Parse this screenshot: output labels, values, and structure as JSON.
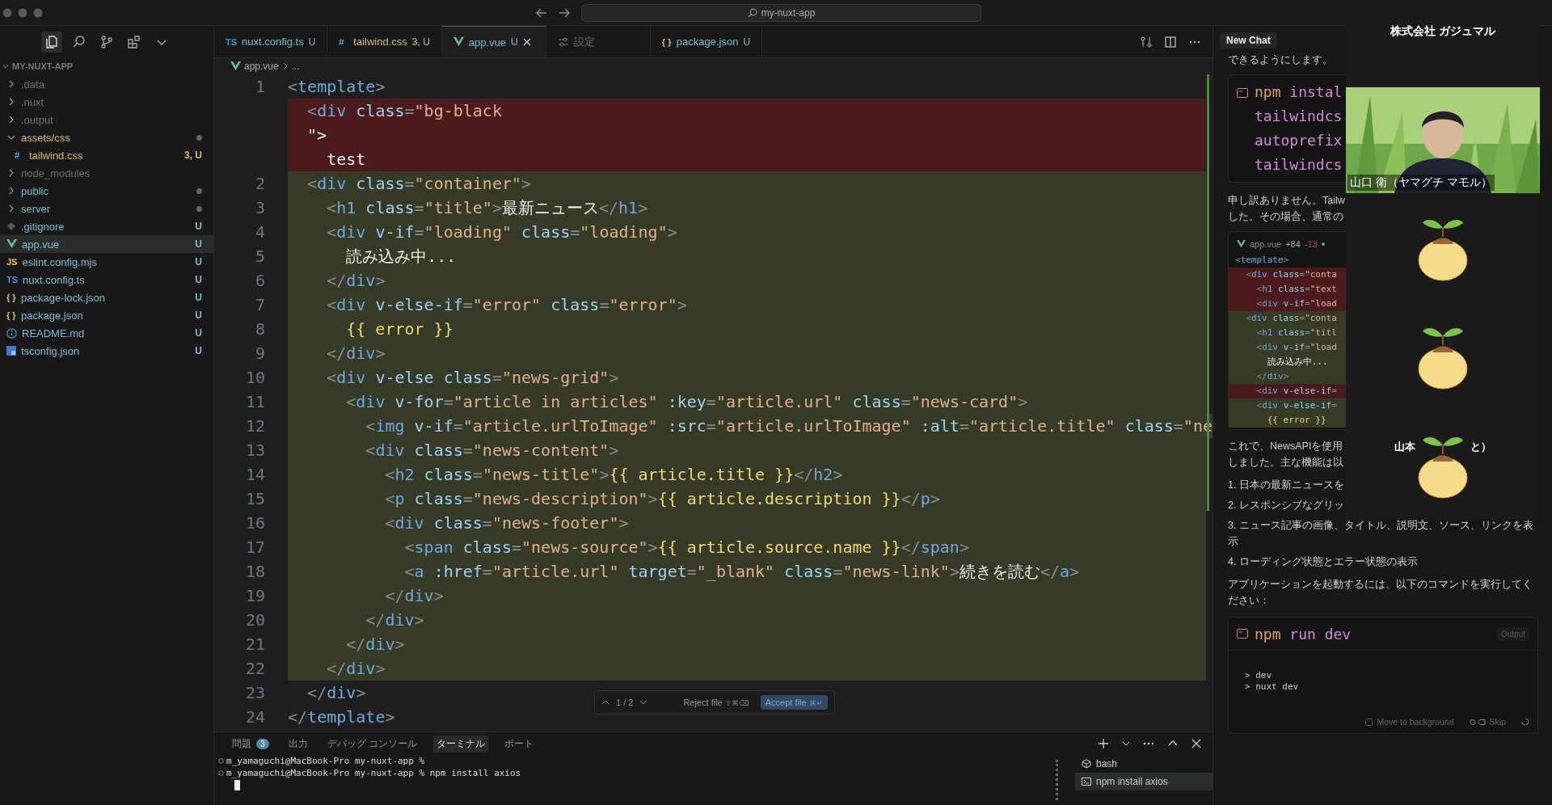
{
  "window": {
    "search": "my-nuxt-app"
  },
  "activity": [
    {
      "kind": "files",
      "selected": true
    },
    {
      "kind": "search",
      "selected": false
    },
    {
      "kind": "git",
      "selected": false
    },
    {
      "kind": "extensions",
      "selected": false
    },
    {
      "kind": "more",
      "selected": false
    }
  ],
  "explorer": {
    "title": "MY-NUXT-APP",
    "items": [
      {
        "name": ".data",
        "kind": "folder",
        "expanded": false,
        "color": "#6f6f6f",
        "selected": false
      },
      {
        "name": ".nuxt",
        "kind": "folder",
        "expanded": false,
        "color": "#6f6f6f",
        "selected": false
      },
      {
        "name": ".output",
        "kind": "folder",
        "expanded": false,
        "color": "#6f6f6f",
        "selected": false
      },
      {
        "name": "assets/css",
        "kind": "folder",
        "expanded": true,
        "color": "#d7ba7d",
        "dot": true,
        "selected": false,
        "children": [
          {
            "name": "tailwind.css",
            "kind": "css",
            "glyph": "#",
            "color": "#d7ba7d",
            "status": "3, U",
            "selected": false
          }
        ]
      },
      {
        "name": "node_modules",
        "kind": "folder",
        "expanded": false,
        "color": "#6f6f6f",
        "selected": false
      },
      {
        "name": "public",
        "kind": "folder",
        "expanded": false,
        "color": "#7fbdd0",
        "dot": true,
        "selected": false
      },
      {
        "name": "server",
        "kind": "folder",
        "expanded": false,
        "color": "#7fbdd0",
        "dot": true,
        "selected": false
      },
      {
        "name": ".gitignore",
        "kind": "gitignore",
        "color": "#7fbdd0",
        "status": "U",
        "selected": false
      },
      {
        "name": "app.vue",
        "kind": "vue",
        "color": "#7fbdd0",
        "status": "U",
        "selected": true
      },
      {
        "name": "eslint.config.mjs",
        "kind": "js",
        "glyph": "JS",
        "color": "#7fbdd0",
        "status": "U",
        "selected": false
      },
      {
        "name": "nuxt.config.ts",
        "kind": "ts",
        "glyph": "TS",
        "color": "#7fbdd0",
        "status": "U",
        "selected": false
      },
      {
        "name": "package-lock.json",
        "kind": "json",
        "glyph": "{ }",
        "color": "#7fbdd0",
        "status": "U",
        "selected": false
      },
      {
        "name": "package.json",
        "kind": "json",
        "glyph": "{ }",
        "color": "#7fbdd0",
        "status": "U",
        "selected": false
      },
      {
        "name": "README.md",
        "kind": "info",
        "color": "#7fbdd0",
        "status": "U",
        "selected": false
      },
      {
        "name": "tsconfig.json",
        "kind": "tsconfig",
        "color": "#7fbdd0",
        "status": "U",
        "selected": false
      }
    ]
  },
  "tabs": [
    {
      "label": "nuxt.config.ts",
      "kind": "ts",
      "glyph": "TS",
      "color": "#7fbdd0",
      "status": "U",
      "selected": false
    },
    {
      "label": "tailwind.css",
      "kind": "css",
      "glyph": "#",
      "color": "#d7ba7d",
      "status": "3, U",
      "selected": false
    },
    {
      "label": "app.vue",
      "kind": "vue",
      "color": "#7fbdd0",
      "status": "U",
      "selected": true
    },
    {
      "label": "設定",
      "kind": "settings",
      "color": "#6f6f6f",
      "selected": false
    },
    {
      "label": "package.json",
      "kind": "json",
      "glyph": "{ }",
      "color": "#7fbdd0",
      "status": "U",
      "selected": false
    }
  ],
  "breadcrumb": [
    "app.vue",
    "..."
  ],
  "code_lines": [
    {
      "number": "1",
      "text": "<template>",
      "deleted": false,
      "added": false
    },
    {
      "text": "  <div class=\"bg-black",
      "deleted": true,
      "added": false
    },
    {
      "text": "  \">",
      "deleted": true,
      "added": false
    },
    {
      "text": "    test",
      "deleted": true,
      "added": false
    },
    {
      "number": "2",
      "text": "  <div class=\"container\">",
      "deleted": false,
      "added": true
    },
    {
      "number": "3",
      "text": "    <h1 class=\"title\">最新ニュース</h1>",
      "deleted": false,
      "added": true
    },
    {
      "number": "4",
      "text": "    <div v-if=\"loading\" class=\"loading\">",
      "deleted": false,
      "added": true
    },
    {
      "number": "5",
      "text": "      読み込み中...",
      "deleted": false,
      "added": true
    },
    {
      "number": "6",
      "text": "    </div>",
      "deleted": false,
      "added": true
    },
    {
      "number": "7",
      "text": "    <div v-else-if=\"error\" class=\"error\">",
      "deleted": false,
      "added": true
    },
    {
      "number": "8",
      "text": "      {{ error }}",
      "deleted": false,
      "added": true
    },
    {
      "number": "9",
      "text": "    </div>",
      "deleted": false,
      "added": true
    },
    {
      "number": "10",
      "text": "    <div v-else class=\"news-grid\">",
      "deleted": false,
      "added": true
    },
    {
      "number": "11",
      "text": "      <div v-for=\"article in articles\" :key=\"article.url\" class=\"news-card\">",
      "deleted": false,
      "added": true
    },
    {
      "number": "12",
      "text": "        <img v-if=\"article.urlToImage\" :src=\"article.urlToImage\" :alt=\"article.title\" class=\"ne",
      "deleted": false,
      "added": true
    },
    {
      "number": "13",
      "text": "        <div class=\"news-content\">",
      "deleted": false,
      "added": true
    },
    {
      "number": "14",
      "text": "          <h2 class=\"news-title\">{{ article.title }}</h2>",
      "deleted": false,
      "added": true
    },
    {
      "number": "15",
      "text": "          <p class=\"news-description\">{{ article.description }}</p>",
      "deleted": false,
      "added": true
    },
    {
      "number": "16",
      "text": "          <div class=\"news-footer\">",
      "deleted": false,
      "added": true
    },
    {
      "number": "17",
      "text": "            <span class=\"news-source\">{{ article.source.name }}</span>",
      "deleted": false,
      "added": true
    },
    {
      "number": "18",
      "text": "            <a :href=\"article.url\" target=\"_blank\" class=\"news-link\">続きを読む</a>",
      "deleted": false,
      "added": true
    },
    {
      "number": "19",
      "text": "          </div>",
      "deleted": false,
      "added": true
    },
    {
      "number": "20",
      "text": "        </div>",
      "deleted": false,
      "added": true
    },
    {
      "number": "21",
      "text": "      </div>",
      "deleted": false,
      "added": true
    },
    {
      "number": "22",
      "text": "    </div>",
      "deleted": false,
      "added": true
    },
    {
      "number": "23",
      "text": "  </div>",
      "deleted": false,
      "added": false
    },
    {
      "number": "24",
      "text": "</template>",
      "deleted": false,
      "added": false
    }
  ],
  "diff_bar": {
    "counter": "1 / 2",
    "reject": "Reject file",
    "reject_keys": "⇧⌘⌫",
    "accept": "Accept file",
    "accept_keys": "⌘↵"
  },
  "panel": {
    "tabs": [
      {
        "label": "問題",
        "badge": "3",
        "selected": false
      },
      {
        "label": "出力",
        "selected": false
      },
      {
        "label": "デバッグ コンソール",
        "selected": false
      },
      {
        "label": "ターミナル",
        "selected": true
      },
      {
        "label": "ポート",
        "selected": false
      }
    ],
    "terminal_lines": [
      "m_yamaguchi@MacBook-Pro my-nuxt-app %",
      "m_yamaguchi@MacBook-Pro my-nuxt-app % npm install axios"
    ],
    "terminals": [
      {
        "label": "bash",
        "kind": "shell",
        "selected": false
      },
      {
        "label": "npm install axios",
        "kind": "task",
        "selected": true
      }
    ]
  },
  "chat": {
    "tab": "New Chat",
    "blocks": [
      {
        "kind": "text",
        "lines": [
          "できるようにします。"
        ]
      },
      {
        "kind": "command",
        "lines": [
          "npm instal",
          "tailwindcs",
          "autoprefix",
          "tailwindcs"
        ]
      },
      {
        "kind": "text",
        "lines": [
          "申し訳ありません。Tailw",
          "した。その場合、通常の"
        ]
      },
      {
        "kind": "diff",
        "file": "app.vue",
        "added": "+84",
        "removed": "-13",
        "lines": [
          {
            "text": "<template>",
            "deleted": false,
            "added": false
          },
          {
            "text": "  <div class=\"conta",
            "deleted": true,
            "added": false
          },
          {
            "text": "    <h1 class=\"text",
            "deleted": true,
            "added": false
          },
          {
            "text": "    <div v-if=\"load",
            "deleted": true,
            "added": false
          },
          {
            "text": "  <div class=\"conta",
            "deleted": false,
            "added": true
          },
          {
            "text": "    <h1 class=\"titl",
            "deleted": false,
            "added": true
          },
          {
            "text": "    <div v-if=\"load",
            "deleted": false,
            "added": true
          },
          {
            "text": "      読み込み中...",
            "deleted": false,
            "added": true
          },
          {
            "text": "    </div>",
            "deleted": false,
            "added": true
          },
          {
            "text": "    <div v-else-if=",
            "deleted": true,
            "added": false
          },
          {
            "text": "    <div v-else-if=",
            "deleted": false,
            "added": true
          },
          {
            "text": "      {{ error }}",
            "deleted": false,
            "added": true
          }
        ]
      },
      {
        "kind": "text",
        "lines": [
          "これで、NewsAPIを使用",
          "しました。主な機能は以"
        ]
      },
      {
        "kind": "list",
        "items": [
          "1. 日本の最新ニュースを",
          "2. レスポンシブなグリッ",
          "3. ニュース記事の画像、タイトル、説明文、ソース、リンクを表示",
          "4. ローディング状態とエラー状態の表示"
        ]
      },
      {
        "kind": "text",
        "lines": [
          "アプリケーションを起動するには、以下のコマンドを実行してください："
        ]
      },
      {
        "kind": "run",
        "command": "npm run dev",
        "badge": "Output",
        "output": [
          "> dev",
          "> nuxt dev"
        ],
        "background": "Move to background",
        "skip": "Skip"
      }
    ]
  },
  "meeting": {
    "title": "株式会社 ガジュマル",
    "participants": [
      {
        "kind": "video",
        "name": "山口 衛（ヤマグチ マモル）"
      },
      {
        "kind": "avatar"
      },
      {
        "kind": "avatar"
      },
      {
        "kind": "avatar",
        "name_parts": [
          "山本",
          "と）"
        ]
      }
    ]
  }
}
